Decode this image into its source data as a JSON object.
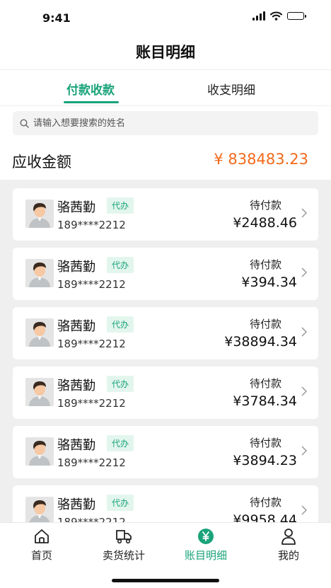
{
  "status_bar": {
    "time": "9:41"
  },
  "header": {
    "title": "账目明细"
  },
  "tabs": [
    {
      "label": "付款收款",
      "active": true
    },
    {
      "label": "收支明细",
      "active": false
    }
  ],
  "search": {
    "placeholder": "请输入想要搜索的姓名"
  },
  "summary": {
    "label": "应收金额",
    "value": "¥ 838483.23"
  },
  "records": [
    {
      "name": "骆茜勤",
      "badge": "代办",
      "phone": "189****2212",
      "status": "待付款",
      "amount": "¥2488.46"
    },
    {
      "name": "骆茜勤",
      "badge": "代办",
      "phone": "189****2212",
      "status": "待付款",
      "amount": "¥394.34"
    },
    {
      "name": "骆茜勤",
      "badge": "代办",
      "phone": "189****2212",
      "status": "待付款",
      "amount": "¥38894.34"
    },
    {
      "name": "骆茜勤",
      "badge": "代办",
      "phone": "189****2212",
      "status": "待付款",
      "amount": "¥3784.34"
    },
    {
      "name": "骆茜勤",
      "badge": "代办",
      "phone": "189****2212",
      "status": "待付款",
      "amount": "¥3894.23"
    },
    {
      "name": "骆茜勤",
      "badge": "代办",
      "phone": "189****2212",
      "status": "待付款",
      "amount": "¥9958.44"
    }
  ],
  "bottom_nav": [
    {
      "label": "首页",
      "icon": "home-icon",
      "active": false
    },
    {
      "label": "卖货统计",
      "icon": "truck-icon",
      "active": false
    },
    {
      "label": "账目明细",
      "icon": "yen-icon",
      "active": true
    },
    {
      "label": "我的",
      "icon": "user-icon",
      "active": false
    }
  ],
  "colors": {
    "accent": "#1aa37a",
    "amount_highlight": "#f2691b",
    "list_background": "#efefef"
  }
}
